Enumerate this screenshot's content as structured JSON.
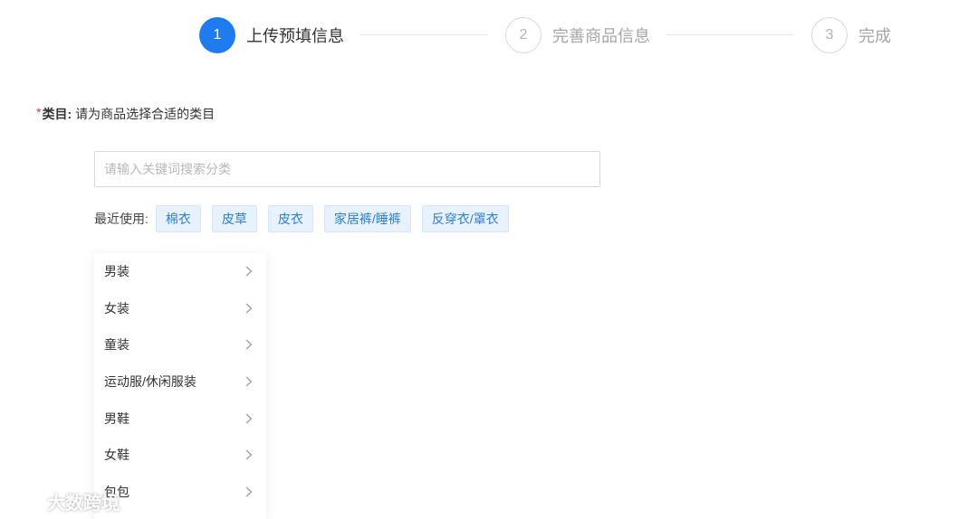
{
  "steps": [
    {
      "number": "1",
      "label": "上传预填信息",
      "state": "active"
    },
    {
      "number": "2",
      "label": "完善商品信息",
      "state": "todo"
    },
    {
      "number": "3",
      "label": "完成",
      "state": "todo"
    }
  ],
  "category_field": {
    "required_mark": "*",
    "label": "类目:",
    "hint": "请为商品选择合适的类目"
  },
  "search": {
    "placeholder": "请输入关键词搜索分类",
    "value": ""
  },
  "recent": {
    "label": "最近使用:",
    "tags": [
      "棉衣",
      "皮草",
      "皮衣",
      "家居裤/睡裤",
      "反穿衣/罩衣"
    ]
  },
  "categories": [
    "男装",
    "女装",
    "童装",
    "运动服/休闲服装",
    "男鞋",
    "女鞋",
    "包包"
  ],
  "watermark": {
    "text": "大数跨境"
  },
  "colors": {
    "primary": "#1f7cf0",
    "tag_bg": "#e8f2fd",
    "tag_text": "#2f7fd8",
    "required": "#e4393c"
  }
}
